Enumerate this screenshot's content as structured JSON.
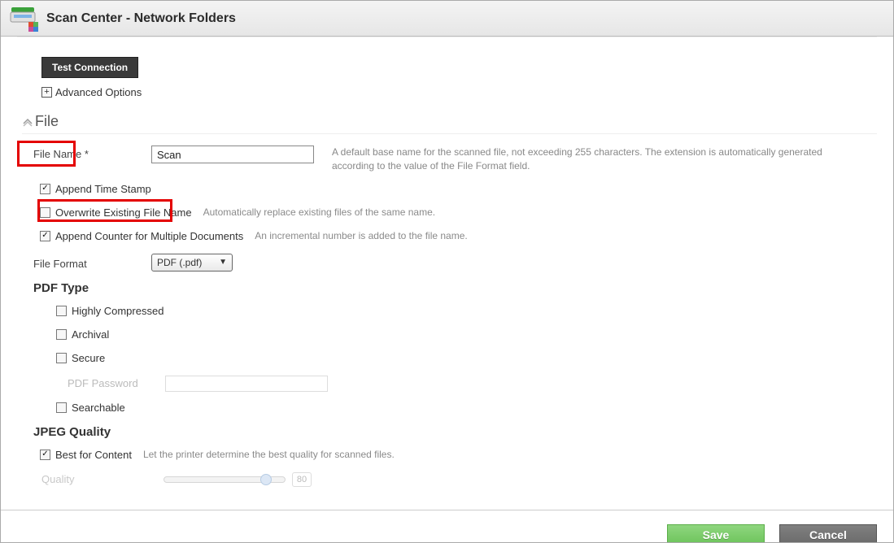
{
  "header": {
    "title": "Scan Center - Network Folders"
  },
  "buttons": {
    "test_connection": "Test Connection",
    "advanced_options": "Advanced Options",
    "save": "Save",
    "cancel": "Cancel"
  },
  "section": {
    "file": "File"
  },
  "fields": {
    "file_name_label": "File Name *",
    "file_name_value": "Scan",
    "file_name_help": "A default base name for the scanned file, not exceeding 255 characters. The extension is automatically generated according to the value of the File Format field.",
    "append_time_stamp": "Append Time Stamp",
    "overwrite_existing": "Overwrite Existing File Name",
    "overwrite_help": "Automatically replace existing files of the same name.",
    "append_counter": "Append Counter for Multiple Documents",
    "append_counter_help": "An incremental number is added to the file name.",
    "file_format_label": "File Format",
    "file_format_value": "PDF (.pdf)"
  },
  "pdf": {
    "heading": "PDF Type",
    "highly_compressed": "Highly Compressed",
    "archival": "Archival",
    "secure": "Secure",
    "password_label": "PDF Password",
    "searchable": "Searchable"
  },
  "jpeg": {
    "heading": "JPEG Quality",
    "best_for_content": "Best for Content",
    "best_help": "Let the printer determine the best quality for scanned files.",
    "quality_label": "Quality",
    "quality_value": "80"
  }
}
